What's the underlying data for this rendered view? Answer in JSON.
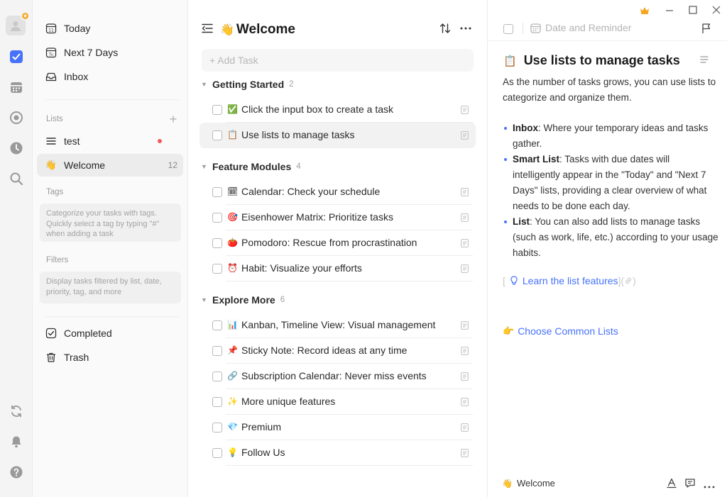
{
  "colors": {
    "accent": "#4772fa",
    "crown": "#f5a623",
    "red_dot": "#f25a5a"
  },
  "rail": {
    "items": [
      {
        "icon": "avatar-icon"
      },
      {
        "icon": "task-check-icon"
      },
      {
        "icon": "calendar-icon"
      },
      {
        "icon": "target-icon"
      },
      {
        "icon": "clock-icon"
      },
      {
        "icon": "search-icon"
      },
      {
        "icon": "sync-icon"
      },
      {
        "icon": "bell-icon"
      },
      {
        "icon": "help-icon"
      }
    ]
  },
  "sidebar": {
    "smart_lists": [
      {
        "label": "Today",
        "icon": "calendar-day-icon"
      },
      {
        "label": "Next 7 Days",
        "icon": "calendar-week-icon"
      },
      {
        "label": "Inbox",
        "icon": "inbox-icon"
      }
    ],
    "lists_title": "Lists",
    "lists": [
      {
        "label": "test",
        "icon": "list-icon"
      },
      {
        "label": "Welcome",
        "icon": "👋",
        "count": "12"
      }
    ],
    "tags_title": "Tags",
    "tags_hint": "Categorize your tasks with tags. Quickly select a tag by typing \"#\" when adding a task",
    "filters_title": "Filters",
    "filters_hint": "Display tasks filtered by list, date, priority, tag, and more",
    "bottom": [
      {
        "label": "Completed",
        "icon": "checkbox-icon"
      },
      {
        "label": "Trash",
        "icon": "trash-icon"
      }
    ]
  },
  "main": {
    "title": "Welcome",
    "title_emoji": "👋",
    "add_task_placeholder": "+ Add Task",
    "sections": [
      {
        "name": "Getting Started",
        "count": "2",
        "tasks": [
          {
            "emoji": "✅",
            "title": "Click the input box to create a task"
          },
          {
            "emoji": "📋",
            "title": "Use lists to manage tasks",
            "selected": true
          }
        ]
      },
      {
        "name": "Feature Modules",
        "count": "4",
        "tasks": [
          {
            "emoji": "🗓",
            "title": "Calendar: Check your schedule"
          },
          {
            "emoji": "🎯",
            "title": "Eisenhower Matrix: Prioritize tasks"
          },
          {
            "emoji": "🍅",
            "title": "Pomodoro: Rescue from procrastination"
          },
          {
            "emoji": "⏰",
            "title": "Habit: Visualize your efforts"
          }
        ]
      },
      {
        "name": "Explore More",
        "count": "6",
        "tasks": [
          {
            "emoji": "📊",
            "title": "Kanban, Timeline View: Visual management"
          },
          {
            "emoji": "📌",
            "title": "Sticky Note: Record ideas at any time"
          },
          {
            "emoji": "🔗",
            "title": "Subscription Calendar: Never miss events"
          },
          {
            "emoji": "✨",
            "title": "More unique features"
          },
          {
            "emoji": "💎",
            "title": "Premium"
          },
          {
            "emoji": "💡",
            "title": "Follow Us"
          }
        ]
      }
    ]
  },
  "detail": {
    "date_reminder": "Date and Reminder",
    "title_emoji": "📋",
    "title": "Use lists to manage tasks",
    "intro": "As the number of tasks grows, you can use lists to categorize and organize them.",
    "bullets": [
      {
        "term": "Inbox",
        "text": ": Where your temporary ideas and tasks gather."
      },
      {
        "term": "Smart List",
        "text": ": Tasks with due dates will intelligently appear in the \"Today\" and \"Next 7 Days\" lists, providing a clear overview of what needs to be done each day."
      },
      {
        "term": "List",
        "text": ": You can also add lists to manage tasks (such as work, life, etc.) according to your usage habits."
      }
    ],
    "learn_link": "Learn the list features",
    "choose_link": "Choose Common Lists",
    "choose_emoji": "👉",
    "footer_list": "Welcome",
    "footer_emoji": "👋"
  }
}
